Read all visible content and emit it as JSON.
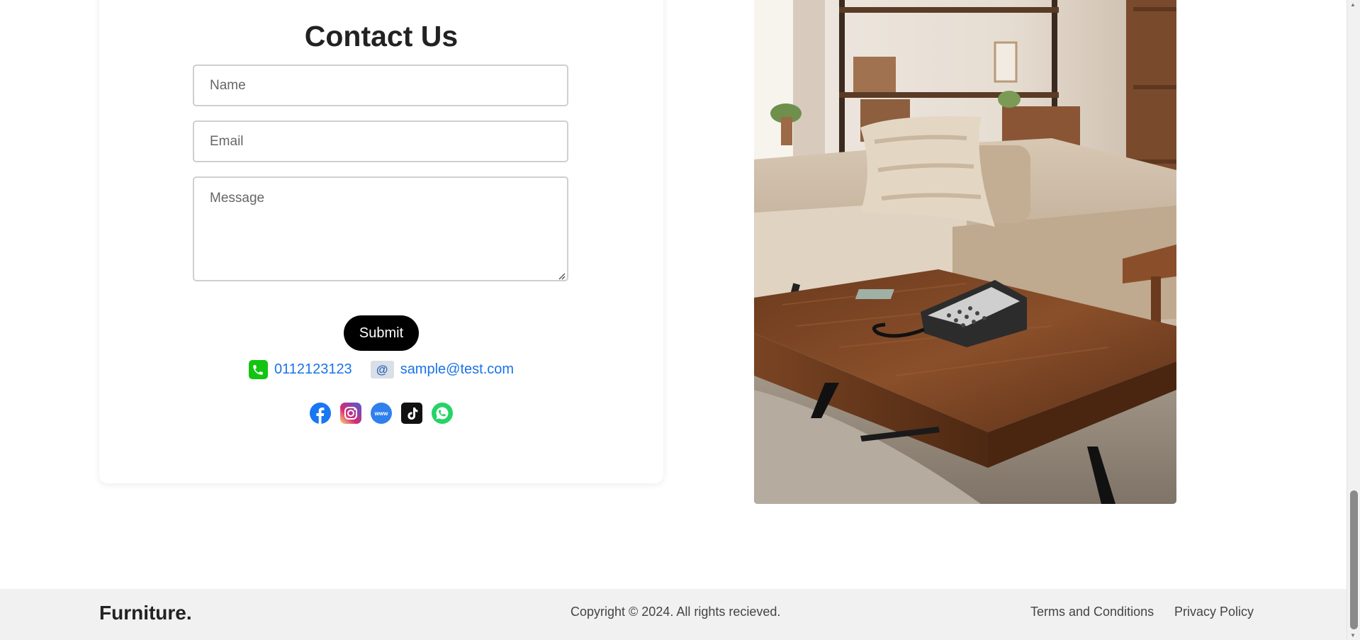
{
  "contact": {
    "title": "Contact Us",
    "name_placeholder": "Name",
    "email_placeholder": "Email",
    "message_placeholder": "Message",
    "submit_label": "Submit",
    "phone": "0112123123",
    "email": "sample@test.com"
  },
  "social": {
    "items": [
      {
        "icon": "facebook-icon"
      },
      {
        "icon": "instagram-icon"
      },
      {
        "icon": "website-icon"
      },
      {
        "icon": "tiktok-icon"
      },
      {
        "icon": "whatsapp-icon"
      }
    ]
  },
  "footer": {
    "brand": "Furniture.",
    "copyright": "Copyright © 2024. All rights recieved.",
    "terms": "Terms and Conditions",
    "privacy": "Privacy Policy"
  },
  "colors": {
    "link": "#1a73e8",
    "submit_bg": "#000000",
    "footer_bg": "#f1f1f1",
    "phone_icon": "#13c413"
  }
}
